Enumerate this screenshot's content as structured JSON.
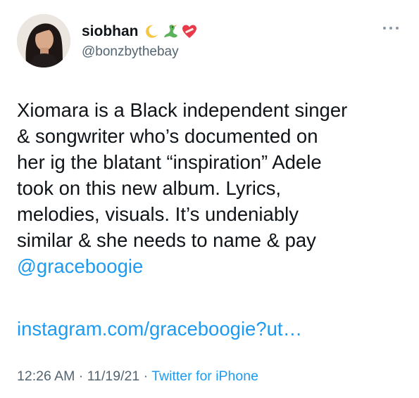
{
  "author": {
    "display_name": "siobhan",
    "emojis": [
      "crescent-moon-icon",
      "dragon-icon",
      "mending-heart-icon"
    ],
    "handle": "@bonzbythebay"
  },
  "tweet": {
    "lines": [
      "Xiomara is a Black independent singer",
      "& songwriter who’s documented on",
      "her ig the blatant “inspiration” Adele",
      "took on this new album. Lyrics,",
      "melodies, visuals. It’s undeniably",
      "similar & she needs to name & pay"
    ],
    "mention": "@graceboogie",
    "link": "instagram.com/graceboogie?ut…"
  },
  "meta": {
    "time": "12:26 AM",
    "separator": " · ",
    "date": "11/19/21",
    "source": "Twitter for iPhone"
  },
  "colors": {
    "link": "#1d9bf0",
    "secondary_text": "#536471",
    "primary_text": "#0f1419"
  }
}
